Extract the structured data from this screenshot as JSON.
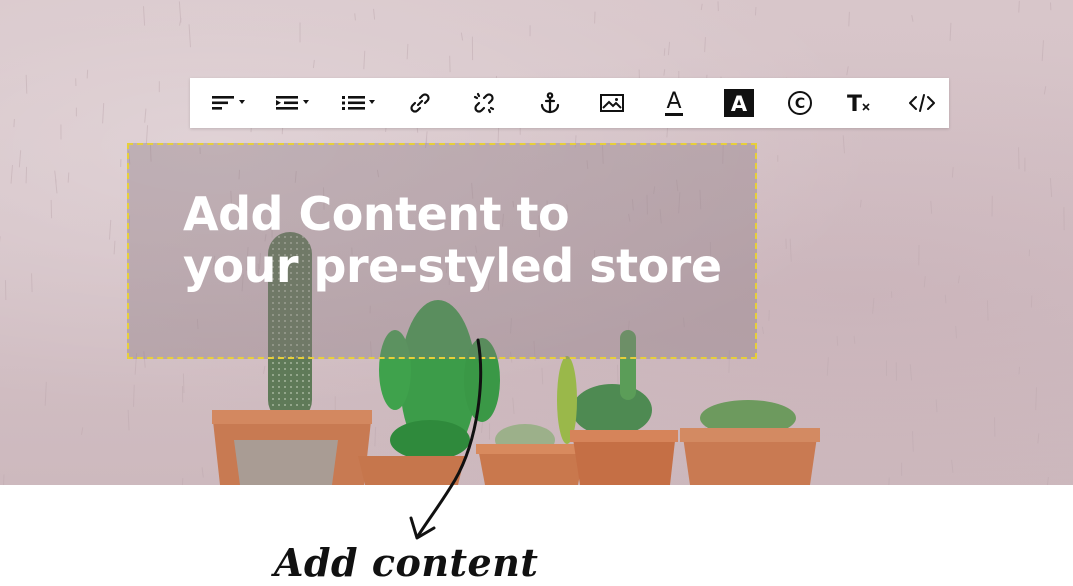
{
  "toolbar": {
    "tools": [
      {
        "name": "align-icon",
        "has_dropdown": true
      },
      {
        "name": "indent-icon",
        "has_dropdown": true
      },
      {
        "name": "list-icon",
        "has_dropdown": true
      },
      {
        "name": "link-icon",
        "has_dropdown": false
      },
      {
        "name": "unlink-icon",
        "has_dropdown": false
      },
      {
        "name": "anchor-icon",
        "has_dropdown": false
      },
      {
        "name": "image-icon",
        "has_dropdown": false
      },
      {
        "name": "text-color-icon",
        "has_dropdown": false
      },
      {
        "name": "background-color-icon",
        "has_dropdown": false
      },
      {
        "name": "copyright-icon",
        "has_dropdown": false
      },
      {
        "name": "clear-format-icon",
        "has_dropdown": false
      },
      {
        "name": "source-code-icon",
        "has_dropdown": false
      }
    ],
    "text_color_glyph": "A",
    "bg_color_glyph": "A",
    "copyright_glyph": "©",
    "clear_format_glyph": "T"
  },
  "headline": {
    "line1": "Add Content to",
    "line2": "your pre-styled store"
  },
  "annotation": {
    "caption": "Add content"
  },
  "colors": {
    "dashed_border": "#e6cf3a",
    "toolbar_bg": "#ffffff",
    "headline_text": "#ffffff"
  }
}
